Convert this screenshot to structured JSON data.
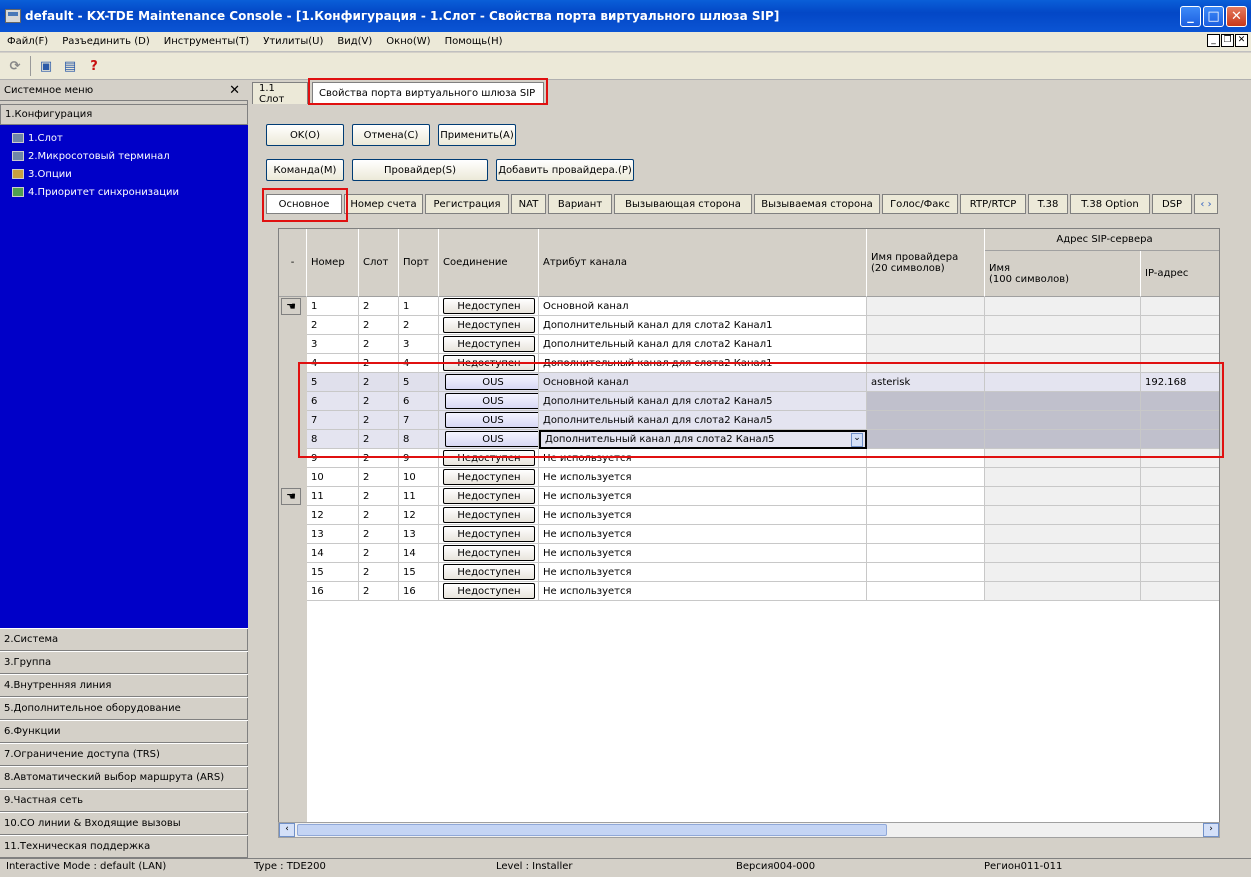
{
  "window": {
    "title": "default - KX-TDE Maintenance Console - [1.Конфигурация - 1.Слот - Свойства порта виртуального шлюза SIP]"
  },
  "menu": [
    "Файл(F)",
    "Разъединить (D)",
    "Инструменты(T)",
    "Утилиты(U)",
    "Вид(V)",
    "Окно(W)",
    "Помощь(H)"
  ],
  "left": {
    "header": "Системное меню",
    "section_config": "1.Конфигурация",
    "tree": [
      "1.Слот",
      "2.Микросотовый терминал",
      "3.Опции",
      "4.Приоритет синхронизации"
    ],
    "sections": [
      "2.Система",
      "3.Группа",
      "4.Внутренняя линия",
      "5.Дополнительное оборудование",
      "6.Функции",
      "7.Ограничение доступа (TRS)",
      "8.Автоматический выбор маршрута (ARS)",
      "9.Частная сеть",
      "10.CO линии & Входящие вызовы",
      "11.Техническая поддержка"
    ]
  },
  "tabs": {
    "slot": "1.1 Слот",
    "sip": "Свойства порта виртуального шлюза SIP"
  },
  "buttons": {
    "ok": "OK(O)",
    "cancel": "Отмена(C)",
    "apply": "Применить(A)",
    "command": "Команда(M)",
    "provider": "Провайдер(S)",
    "add_provider": "Добавить провайдера.(P)"
  },
  "subtabs": [
    "Основное",
    "Номер счета",
    "Регистрация",
    "NAT",
    "Вариант",
    "Вызывающая сторона",
    "Вызываемая сторона",
    "Голос/Факс",
    "RTP/RTCP",
    "T.38",
    "T.38 Option",
    "DSP"
  ],
  "grid": {
    "headers": {
      "dash": "-",
      "num": "Номер",
      "slot": "Слот",
      "port": "Порт",
      "conn": "Соединение",
      "attr": "Атрибут канала",
      "provider": "Имя провайдера",
      "provider2": "(20 символов)",
      "sip": "Адрес SIP-сервера",
      "name": "Имя",
      "name2": "(100 символов)",
      "ip": "IP-адрес"
    },
    "rows": [
      {
        "n": "1",
        "s": "2",
        "p": "1",
        "c": "Недоступен",
        "a": "Основной канал",
        "prov": "",
        "ip": ""
      },
      {
        "n": "2",
        "s": "2",
        "p": "2",
        "c": "Недоступен",
        "a": "Дополнительный канал для слота2 Канал1",
        "prov": "",
        "ip": ""
      },
      {
        "n": "3",
        "s": "2",
        "p": "3",
        "c": "Недоступен",
        "a": "Дополнительный канал для слота2 Канал1",
        "prov": "",
        "ip": ""
      },
      {
        "n": "4",
        "s": "2",
        "p": "4",
        "c": "Недоступен",
        "a": "Дополнительный канал для слота2 Канал1",
        "prov": "",
        "ip": ""
      },
      {
        "n": "5",
        "s": "2",
        "p": "5",
        "c": "OUS",
        "a": "Основной канал",
        "prov": "asterisk",
        "ip": "192.168"
      },
      {
        "n": "6",
        "s": "2",
        "p": "6",
        "c": "OUS",
        "a": "Дополнительный канал для слота2 Канал5",
        "prov": "",
        "ip": ""
      },
      {
        "n": "7",
        "s": "2",
        "p": "7",
        "c": "OUS",
        "a": "Дополнительный канал для слота2 Канал5",
        "prov": "",
        "ip": ""
      },
      {
        "n": "8",
        "s": "2",
        "p": "8",
        "c": "OUS",
        "a": "Дополнительный канал для слота2 Канал5",
        "prov": "",
        "ip": ""
      },
      {
        "n": "9",
        "s": "2",
        "p": "9",
        "c": "Недоступен",
        "a": "Не используется",
        "prov": "",
        "ip": ""
      },
      {
        "n": "10",
        "s": "2",
        "p": "10",
        "c": "Недоступен",
        "a": "Не используется",
        "prov": "",
        "ip": ""
      },
      {
        "n": "11",
        "s": "2",
        "p": "11",
        "c": "Недоступен",
        "a": "Не используется",
        "prov": "",
        "ip": ""
      },
      {
        "n": "12",
        "s": "2",
        "p": "12",
        "c": "Недоступен",
        "a": "Не используется",
        "prov": "",
        "ip": ""
      },
      {
        "n": "13",
        "s": "2",
        "p": "13",
        "c": "Недоступен",
        "a": "Не используется",
        "prov": "",
        "ip": ""
      },
      {
        "n": "14",
        "s": "2",
        "p": "14",
        "c": "Недоступен",
        "a": "Не используется",
        "prov": "",
        "ip": ""
      },
      {
        "n": "15",
        "s": "2",
        "p": "15",
        "c": "Недоступен",
        "a": "Не используется",
        "prov": "",
        "ip": ""
      },
      {
        "n": "16",
        "s": "2",
        "p": "16",
        "c": "Недоступен",
        "a": "Не используется",
        "prov": "",
        "ip": ""
      }
    ]
  },
  "status": {
    "mode": "Interactive Mode : default (LAN)",
    "type": "Type : TDE200",
    "level": "Level : Installer",
    "version": "Версия004-000",
    "region": "Регион011-011"
  }
}
